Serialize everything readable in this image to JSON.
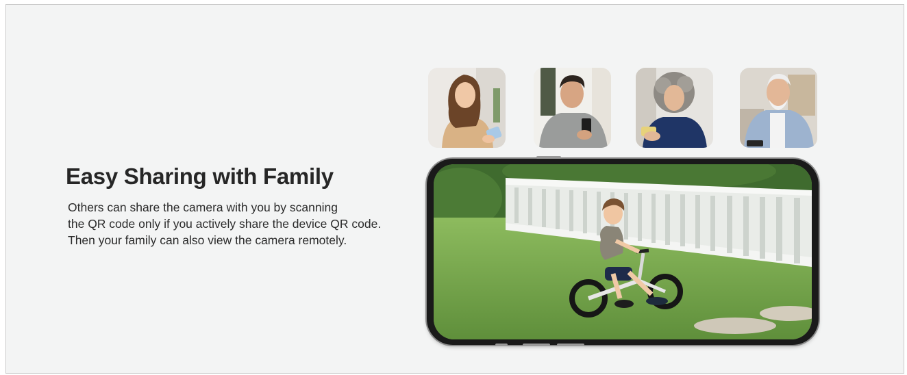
{
  "section": {
    "title": "Easy Sharing with Family",
    "description_lines": [
      "Others can share the camera with you by scanning",
      "the QR code only if you actively share the device QR code.",
      "Then your family can also view the camera remotely."
    ]
  },
  "avatars": [
    {
      "name": "young-woman-with-phone"
    },
    {
      "name": "man-with-phone"
    },
    {
      "name": "older-woman-with-phone"
    },
    {
      "name": "older-man-with-phone"
    }
  ],
  "phone_screen": {
    "scene": "child riding balance bike on lawn"
  }
}
